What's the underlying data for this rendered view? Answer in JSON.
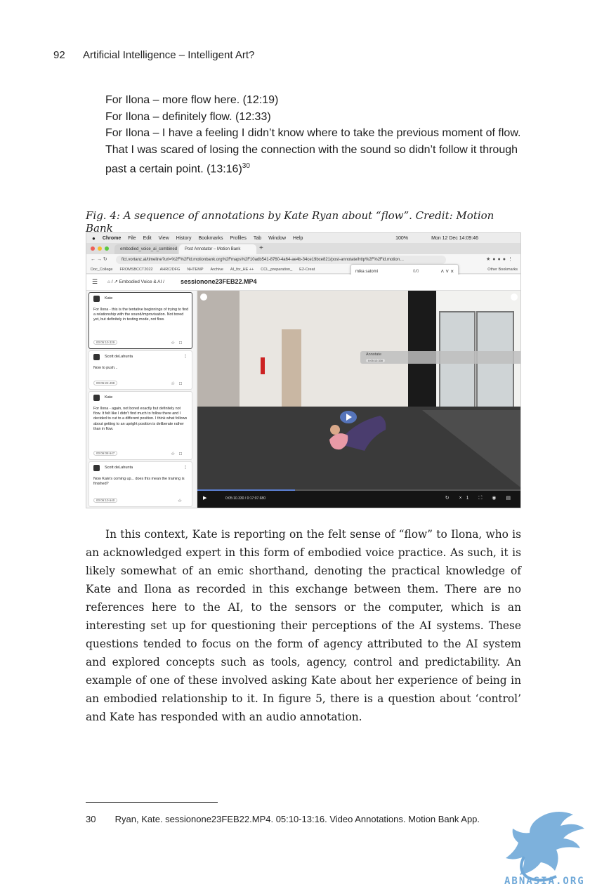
{
  "header": {
    "page_number": "92",
    "running_title": "Artificial Intelligence – Intelligent Art?"
  },
  "quote": {
    "line1": "For Ilona – more flow here. (12:19)",
    "line2": "For Ilona – definitely flow. (12:33)",
    "line3": "For Ilona – I have a feeling I didn’t know where to take the previous moment of flow. That I was scared of losing the connection with the sound so didn’t follow it through past a certain point. (13:16)",
    "footnote_ref": "30"
  },
  "figure_caption": "Fig. 4: A sequence of annotations by Kate Ryan about “flow”. Credit: Motion Bank",
  "screenshot": {
    "mac_menu": [
      "Chrome",
      "File",
      "Edit",
      "View",
      "History",
      "Bookmarks",
      "Profiles",
      "Tab",
      "Window",
      "Help"
    ],
    "clock": "Mon 12 Dec 14:09:46",
    "battery": "100%",
    "tab1": "embodied_voice_ai_combined",
    "tab2": "Post Annotator – Motion Bank",
    "url": "fict.vortanz.ai/timeline?url=%2F%2Fid.motionbank.org%2Fmaps%2F10adb541-8760-4a64-ae4b-34ce19bce821/post-annotate/http%2F%2Fid.motion…",
    "bookmarks": [
      "Doc_College",
      "FROMSBCCT2022",
      "AHRC/DFG",
      "NHTEMP",
      "Archive",
      "AI_for_HE ++",
      "CCL_preparation_",
      "E2-Creat"
    ],
    "other_bookmarks": "Other Bookmarks",
    "find_text": "mika satomi",
    "find_count": "0/0",
    "breadcrumb": "Embodied Voice & AI /",
    "session_title": "sessionone23FEB22.MP4",
    "annotation_placeholder": "Annotate",
    "annotation_chip": "0:05:10.330",
    "video_time": "0:05:10.330 / 0:17:07.680",
    "speed": "×1",
    "cards": [
      {
        "author": "Kate",
        "text": "For Ilona - this is the tentative beginnings of trying to find a relationship with the sound/improvisation. Not bored yet, but definitely in testing mode, not flow.",
        "timestamp": "00:05:10.329"
      },
      {
        "author": "Scott deLahunta",
        "text": "Now to push...",
        "timestamp": "00:05:22.498"
      },
      {
        "author": "Kate",
        "text": "For Ilona - again, not bored exactly but definitely not flow. It felt like I didn't find much to follow there and I decided to cut to a different position. I think what follows about getting to an upright position is deliberate rather than in flow.",
        "timestamp": "00:06:08.647"
      },
      {
        "author": "Scott deLahunta",
        "text": "Now Kate's coming up... does this mean the training is finished?",
        "timestamp": "00:06:10.640"
      }
    ]
  },
  "body_text": "In this context, Kate is reporting on the felt sense of “flow” to Ilona, who is an acknowledged expert in this form of embodied voice practice. As such, it is likely somewhat of an emic shorthand, denoting the practical knowledge of Kate and Ilona as recorded in this exchange between them. There are no references here to the AI, to the sensors or the computer, which is an interesting set up for questioning their perceptions of the AI systems. These questions tended to focus on the form of agency attributed to the AI system and explored concepts such as tools, agency, control and predictability. An example of one of these involved asking Kate about her experience of being in an embodied relationship to it. In figure 5, there is a question about ‘control’ and Kate has responded with an audio annotation.",
  "footnote": {
    "number": "30",
    "text": "Ryan, Kate. sessionone23FEB22.MP4. 05:10-13:16. Video Annotations. Motion Bank App."
  },
  "watermark": "ABNASIA.ORG",
  "colors": {
    "logo_blue": "#6fa8d8",
    "video_floor": "#3a3a3a",
    "play_button": "#6c8fd8"
  }
}
